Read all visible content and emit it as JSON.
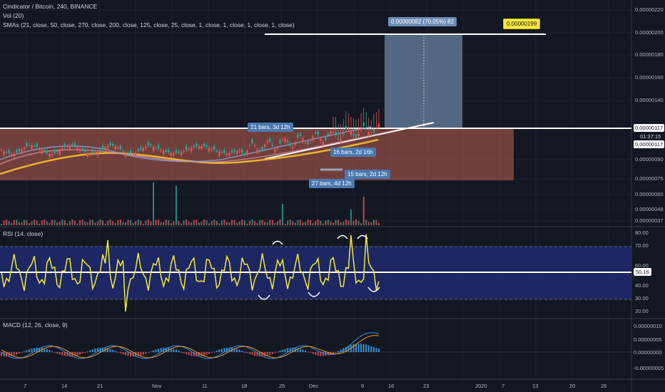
{
  "header": {
    "symbol_line": "Cindicator / Bitcoin, 240, BINANCE",
    "vol_line": "Vol (20)",
    "sma_line": "SMAs (21, close, 50, close, 270, close, 200, close, 125, close, 25, close, 1, close, 1, close, 1, close, 1, close)"
  },
  "panes": {
    "rsi_label": "RSI (14, close)",
    "macd_label": "MACD (12, 26, close, 9)"
  },
  "price_axis": {
    "ticks": [
      "0.00000220",
      "0.00000200",
      "0.00000180",
      "0.00000160",
      "0.00000140",
      "0.00000090",
      "0.00000075",
      "0.00000060",
      "0.00000048",
      "0.00000037"
    ],
    "current_price": "0.00000117",
    "countdown": "01:37:15",
    "price_line": "0.00000117"
  },
  "rsi_axis": {
    "ticks": [
      "80.00",
      "70.00",
      "60.00",
      "40.00",
      "30.00",
      "20.00"
    ],
    "current": "50.16"
  },
  "macd_axis": {
    "ticks": [
      "0.00000010",
      "0.00000005",
      "0.00000000",
      "-0.00000005"
    ]
  },
  "time_axis": {
    "labels": [
      "7",
      "14",
      "21",
      "Nov",
      "11",
      "18",
      "25",
      "Dec",
      "9",
      "16",
      "23",
      "2020",
      "7",
      "13",
      "20",
      "26"
    ]
  },
  "annotations": {
    "measure": "0.00000082 (70.05%) 82",
    "target": "0.00000199",
    "bars_a": "21 bars, 3d 12h",
    "bars_b": "16 bars, 2d 16h",
    "bars_c": "15 bars, 2d 12h",
    "bars_d": "27 bars, 4d 12h"
  },
  "colors": {
    "background": "#131722",
    "zone": "#c06050",
    "rsi_band": "#1e2a6e",
    "rsi_line": "#f5e83a",
    "measure_box": "#7f9cc0",
    "target_tag": "#f5e83a",
    "sma_gold": "#e8b32e",
    "sma_pink": "#d48fa5",
    "sma_blue": "#8fa4d8"
  }
}
